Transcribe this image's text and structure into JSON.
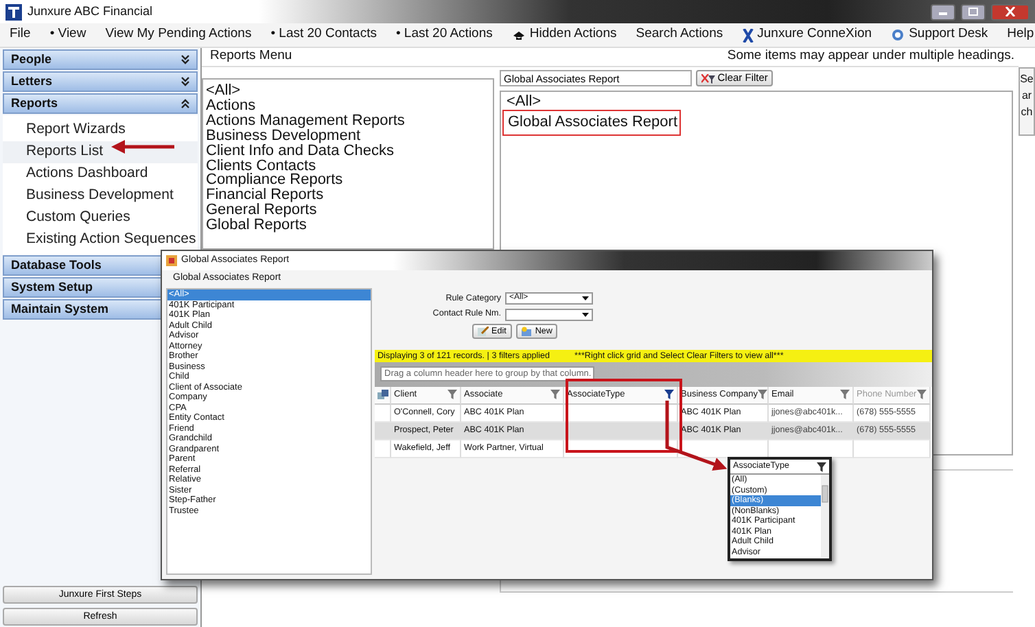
{
  "window": {
    "title": "Junxure ABC Financial"
  },
  "menu": [
    {
      "label": "File",
      "kind": "plain"
    },
    {
      "label": "• View",
      "kind": "plain"
    },
    {
      "label": "View My Pending Actions",
      "kind": "plain"
    },
    {
      "label": "• Last 20 Contacts",
      "kind": "plain"
    },
    {
      "label": "• Last 20 Actions",
      "kind": "plain"
    },
    {
      "label": "Hidden Actions",
      "kind": "hat"
    },
    {
      "label": "Search Actions",
      "kind": "plain"
    }
  ],
  "menu_right": [
    {
      "label": "Junxure ConneXion",
      "kind": "x"
    },
    {
      "label": "Support Desk",
      "kind": "help"
    },
    {
      "label": "Help",
      "kind": "plain"
    }
  ],
  "sidebar": [
    {
      "label": "People",
      "expanded": false
    },
    {
      "label": "Letters",
      "expanded": false
    },
    {
      "label": "Reports",
      "expanded": true,
      "items": [
        {
          "label": "Report Wizards",
          "selected": false
        },
        {
          "label": "Reports List",
          "selected": true
        },
        {
          "label": "Actions Dashboard",
          "selected": false
        },
        {
          "label": "Business Development",
          "selected": false
        },
        {
          "label": "Custom Queries",
          "selected": false
        },
        {
          "label": "Existing Action Sequences",
          "selected": false
        }
      ]
    },
    {
      "label": "Database Tools",
      "expanded": false
    },
    {
      "label": "System Setup",
      "expanded": false
    },
    {
      "label": "Maintain System",
      "expanded": false
    }
  ],
  "sidebar_buttons": [
    "Junxure First Steps",
    "Refresh"
  ],
  "toolbar": {
    "title": "Reports Menu",
    "note": "Some items may appear under multiple headings."
  },
  "side_tab": "Search",
  "report_categories": [
    "<All>",
    "Actions",
    "Actions Management Reports",
    "Business Development",
    "Client Info and Data Checks",
    "Clients Contacts",
    "Compliance Reports",
    "Financial Reports",
    "General Reports",
    "Global Reports"
  ],
  "filter": {
    "value": "Global Associates Report",
    "button": "Clear Filter"
  },
  "reports": [
    {
      "label": "<All>",
      "highlighted": false
    },
    {
      "label": "Global Associates Report",
      "highlighted": true
    }
  ],
  "report_window": {
    "title": "Global Associates Report",
    "header": "Global Associates Report",
    "associate_types": [
      {
        "label": "<All>",
        "selected": true
      },
      {
        "label": "401K Participant",
        "selected": false
      },
      {
        "label": "401K Plan",
        "selected": false
      },
      {
        "label": "Adult Child",
        "selected": false
      },
      {
        "label": "Advisor",
        "selected": false
      },
      {
        "label": "Attorney",
        "selected": false
      },
      {
        "label": "Brother",
        "selected": false
      },
      {
        "label": "Business",
        "selected": false
      },
      {
        "label": "Child",
        "selected": false
      },
      {
        "label": "Client of Associate",
        "selected": false
      },
      {
        "label": "Company",
        "selected": false
      },
      {
        "label": "CPA",
        "selected": false
      },
      {
        "label": "Entity Contact",
        "selected": false
      },
      {
        "label": "Friend",
        "selected": false
      },
      {
        "label": "Grandchild",
        "selected": false
      },
      {
        "label": "Grandparent",
        "selected": false
      },
      {
        "label": "Parent",
        "selected": false
      },
      {
        "label": "Referral",
        "selected": false
      },
      {
        "label": "Relative",
        "selected": false
      },
      {
        "label": "Sister",
        "selected": false
      },
      {
        "label": "Step-Father",
        "selected": false
      },
      {
        "label": "Trustee",
        "selected": false
      }
    ],
    "rule_category": {
      "label": "Rule Category",
      "value": "<All>"
    },
    "contact_rule": {
      "label": "Contact Rule Nm."
    },
    "buttons": [
      {
        "label": "Edit",
        "kind": "edit"
      },
      {
        "label": "New",
        "kind": "new"
      }
    ],
    "status": "Displaying 3 of 121 records. | 3 filters applied",
    "status_hint": "***Right click grid and Select Clear Filters to view all***",
    "group_hint": "Drag a column header here to group by that column.",
    "columns": [
      {
        "label": "Client",
        "filtered": false
      },
      {
        "label": "Associate",
        "filtered": false
      },
      {
        "label": "AssociateType",
        "filtered": true,
        "highlighted": true
      },
      {
        "label": "Business Company",
        "filtered": false
      },
      {
        "label": "Email",
        "filtered": false
      },
      {
        "label": "Phone Number",
        "filtered": false
      }
    ],
    "rows": [
      {
        "selected": false,
        "cells": [
          "O'Connell, Cory",
          "ABC 401K Plan",
          "",
          "ABC 401K Plan",
          "jjones@abc401k...",
          "(678) 555-5555"
        ]
      },
      {
        "selected": true,
        "cells": [
          "Prospect, Peter",
          "ABC 401K Plan",
          "",
          "ABC 401K Plan",
          "jjones@abc401k...",
          "(678) 555-5555"
        ]
      },
      {
        "selected": false,
        "cells": [
          "Wakefield, Jeff",
          "Work Partner, Virtual",
          "",
          "",
          "",
          ""
        ]
      }
    ],
    "filter_popup": {
      "title": "AssociateType",
      "items": [
        {
          "label": "(All)",
          "selected": false
        },
        {
          "label": "(Custom)",
          "selected": false
        },
        {
          "label": "(Blanks)",
          "selected": true
        },
        {
          "label": "(NonBlanks)",
          "selected": false
        },
        {
          "label": "401K Participant",
          "selected": false
        },
        {
          "label": "401K Plan",
          "selected": false
        },
        {
          "label": "Adult Child",
          "selected": false
        },
        {
          "label": "Advisor",
          "selected": false
        }
      ]
    }
  }
}
